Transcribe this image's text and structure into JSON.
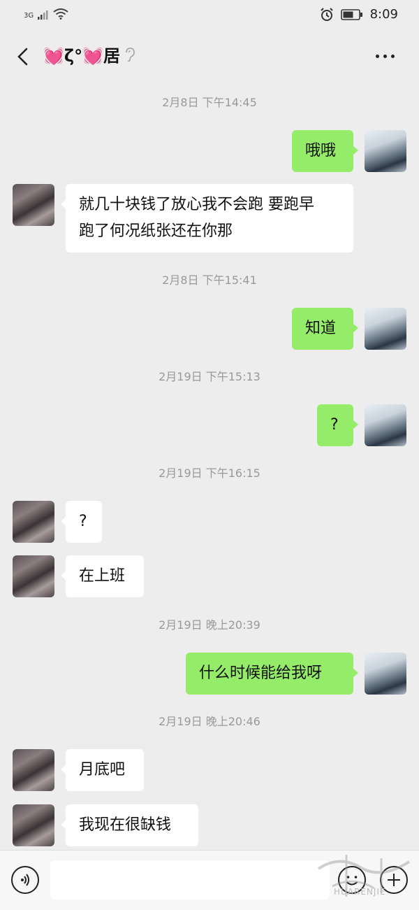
{
  "status_bar": {
    "network": "3G",
    "time": "8:09",
    "icons": [
      "signal-icon",
      "wifi-icon",
      "alarm-icon",
      "battery-icon"
    ]
  },
  "header": {
    "title": "💓ζ°💓居",
    "icons": [
      "back-icon",
      "ear-icon",
      "more-icon"
    ]
  },
  "messages": [
    {
      "type": "time",
      "text": "2月8日 下午14:45"
    },
    {
      "type": "msg",
      "sender": "me",
      "text": "哦哦"
    },
    {
      "type": "msg",
      "sender": "them",
      "text": "就几十块钱了放心我不会跑 要跑早\n跑了何况纸张还在你那"
    },
    {
      "type": "time",
      "text": "2月8日 下午15:41"
    },
    {
      "type": "msg",
      "sender": "me",
      "text": "知道"
    },
    {
      "type": "time",
      "text": "2月19日 下午15:13"
    },
    {
      "type": "msg",
      "sender": "me",
      "text": "?"
    },
    {
      "type": "time",
      "text": "2月19日 下午16:15"
    },
    {
      "type": "msg",
      "sender": "them",
      "text": "?"
    },
    {
      "type": "msg",
      "sender": "them",
      "text": "在上班"
    },
    {
      "type": "time",
      "text": "2月19日 晚上20:39"
    },
    {
      "type": "msg",
      "sender": "me",
      "text": "什么时候能给我呀"
    },
    {
      "type": "time",
      "text": "2月19日 晚上20:46"
    },
    {
      "type": "msg",
      "sender": "them",
      "text": "月底吧"
    },
    {
      "type": "msg",
      "sender": "them",
      "text": "我现在很缺钱"
    }
  ],
  "input_bar": {
    "icons": [
      "voice-icon",
      "emoji-icon",
      "plus-icon"
    ],
    "value": ""
  },
  "watermark": {
    "text": "HUARENJIE"
  },
  "colors": {
    "background": "#ededed",
    "my_bubble": "#95ec69",
    "their_bubble": "#ffffff",
    "timestamp": "#999999"
  }
}
